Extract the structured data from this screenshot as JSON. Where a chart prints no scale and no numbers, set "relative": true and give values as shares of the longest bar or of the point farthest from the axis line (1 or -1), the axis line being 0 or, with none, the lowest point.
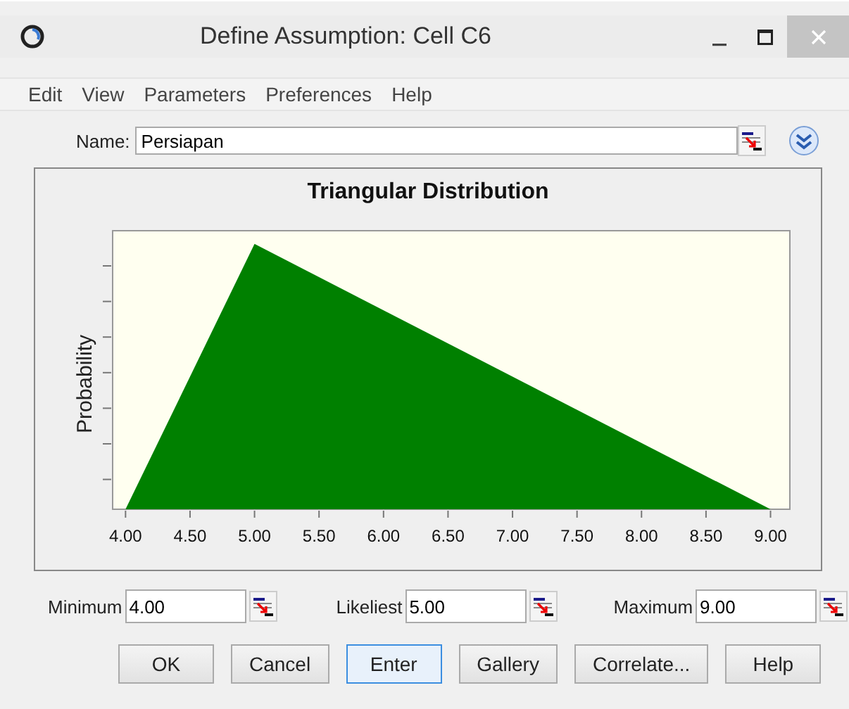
{
  "window": {
    "title": "Define Assumption: Cell C6"
  },
  "menu": [
    {
      "label": "Edit"
    },
    {
      "label": "View"
    },
    {
      "label": "Parameters"
    },
    {
      "label": "Preferences"
    },
    {
      "label": "Help"
    }
  ],
  "name_field": {
    "label": "Name:",
    "value": "Persiapan"
  },
  "chart_data": {
    "type": "area",
    "title": "Triangular Distribution",
    "ylabel": "Probability",
    "xlim": [
      3.9,
      9.15
    ],
    "relative": true,
    "x": [
      4,
      5,
      9
    ],
    "series": [
      {
        "color": "#008000",
        "values": [
          0,
          1,
          0
        ]
      }
    ],
    "xticks": [
      {
        "value": 4,
        "label": "4.00"
      },
      {
        "value": 4.5,
        "label": "4.50"
      },
      {
        "value": 5,
        "label": "5.00"
      },
      {
        "value": 5.5,
        "label": "5.50"
      },
      {
        "value": 6,
        "label": "6.00"
      },
      {
        "value": 6.5,
        "label": "6.50"
      },
      {
        "value": 7,
        "label": "7.00"
      },
      {
        "value": 7.5,
        "label": "7.50"
      },
      {
        "value": 8,
        "label": "8.00"
      },
      {
        "value": 8.5,
        "label": "8.50"
      },
      {
        "value": 9,
        "label": "9.00"
      }
    ]
  },
  "parameters": [
    {
      "label": "Minimum",
      "value": "4.00"
    },
    {
      "label": "Likeliest",
      "value": "5.00"
    },
    {
      "label": "Maximum",
      "value": "9.00"
    }
  ],
  "buttons": [
    {
      "label": "OK",
      "focused": false
    },
    {
      "label": "Cancel",
      "focused": false
    },
    {
      "label": "Enter",
      "focused": true
    },
    {
      "label": "Gallery",
      "focused": false
    },
    {
      "label": "Correlate...",
      "focused": false
    },
    {
      "label": "Help",
      "focused": false
    }
  ]
}
